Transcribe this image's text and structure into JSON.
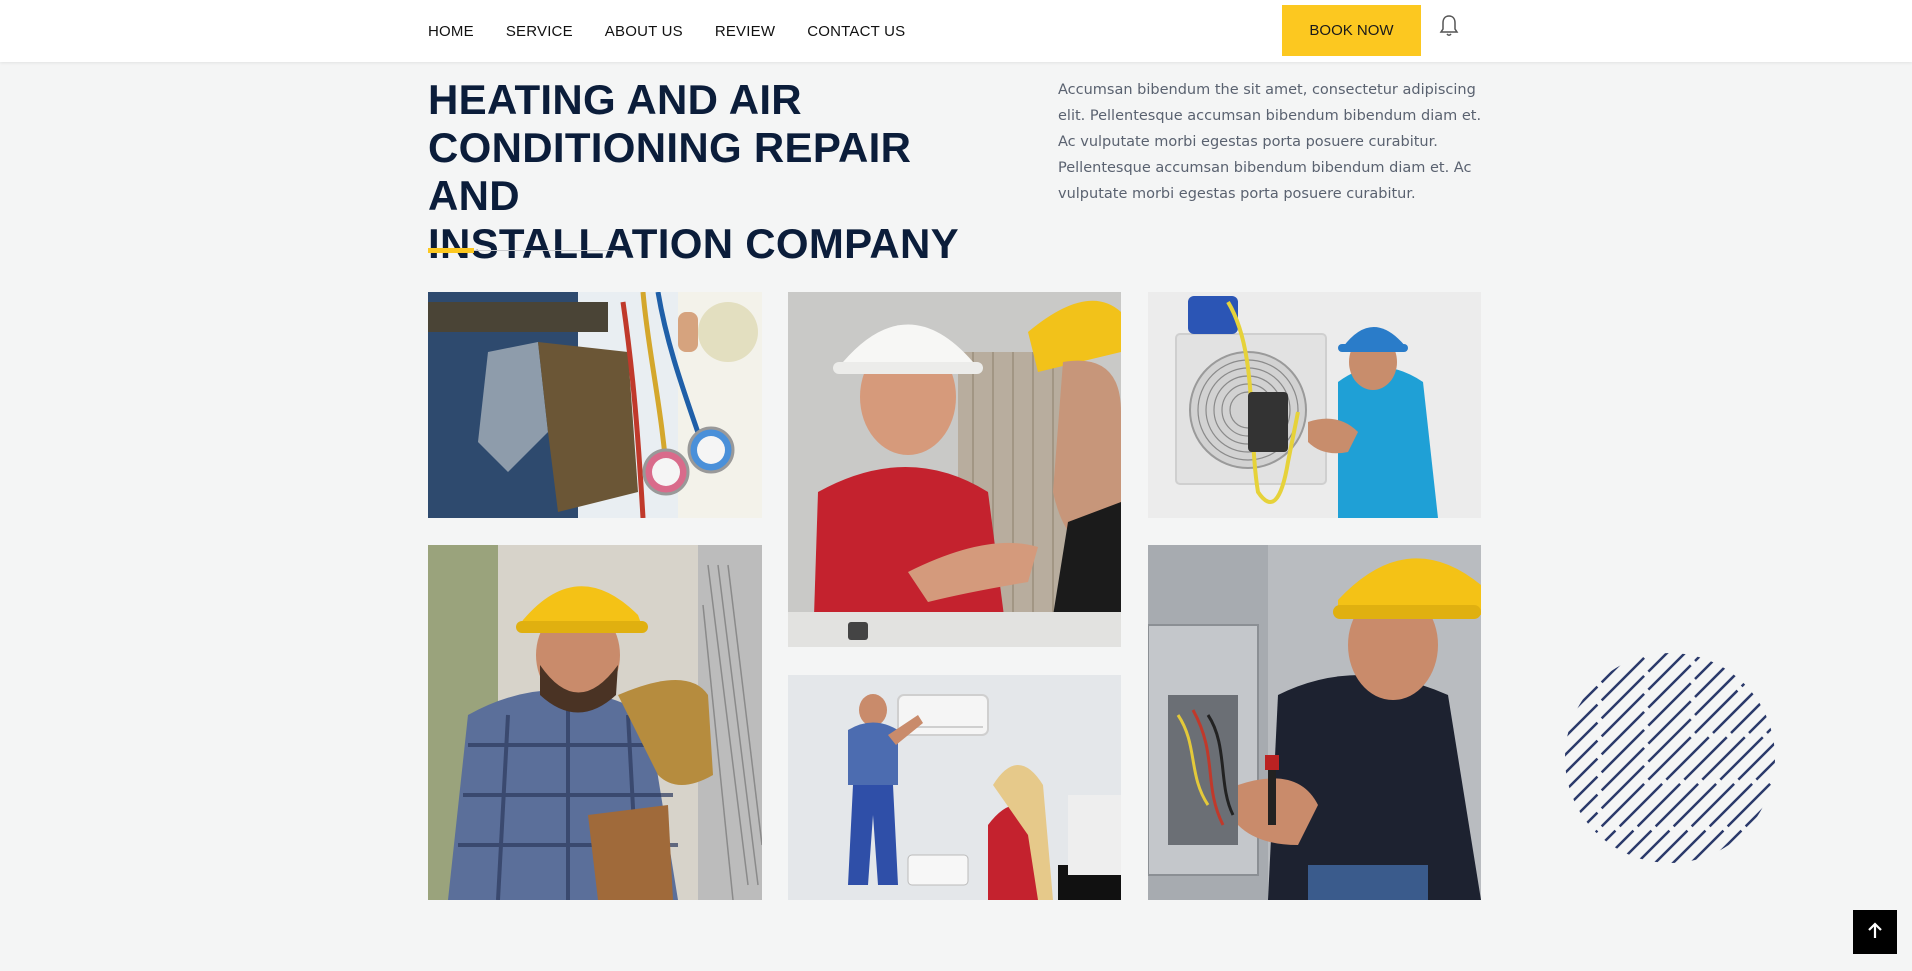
{
  "nav": {
    "items": [
      {
        "label": "HOME"
      },
      {
        "label": "SERVICE"
      },
      {
        "label": "ABOUT US"
      },
      {
        "label": "REVIEW"
      },
      {
        "label": "CONTACT US"
      }
    ],
    "book_label": "BOOK NOW"
  },
  "hero": {
    "title_line1": "HEATING AND AIR",
    "title_line2": "CONDITIONING REPAIR AND",
    "title_line3": "INSTALLATION COMPANY",
    "intro": "Accumsan bibendum the sit amet, consectetur adipiscing elit. Pellentesque accumsan bibendum bibendum diam et. Ac vulputate morbi egestas porta posuere curabitur. Pellentesque accumsan bibendum bibendum diam et. Ac vulputate morbi egestas porta posuere curabitur."
  },
  "colors": {
    "accent": "#fcc820",
    "heading": "#0b1d3a",
    "body_text": "#5a6270",
    "background": "#f4f5f5",
    "decor_stripes": "#2b3a6b"
  },
  "icons": {
    "notification": "bell-icon",
    "scroll_top": "arrow-up-icon"
  }
}
